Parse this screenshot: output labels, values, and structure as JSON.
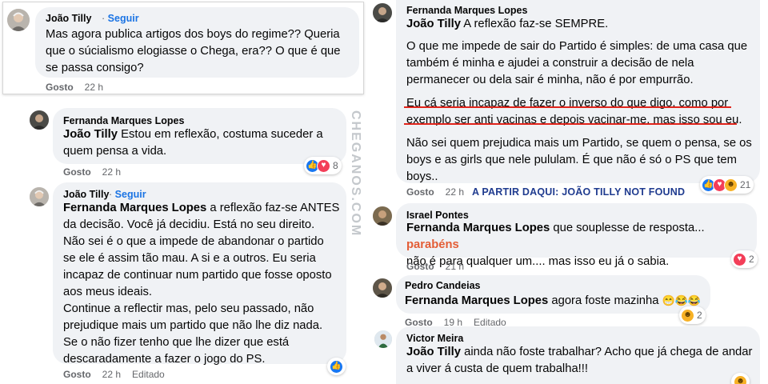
{
  "accent_colors": {
    "link_blue": "#1b74e4",
    "underline_red": "#e0241b",
    "note_blue": "#1f3b8f",
    "highlight_orange": "#e35d36"
  },
  "watermark": "CHEGANOS.COM",
  "comments": {
    "c1": {
      "author": "João Tilly",
      "follow_separator": "·",
      "follow_label": "Seguir",
      "lines": [
        "Mas agora publica artigos dos boys do regime?? Queria",
        "que o súcialismo elogiasse o Chega, era?? O que é que",
        "se passa consigo?"
      ],
      "like_label": "Gosto",
      "time": "22 h"
    },
    "c2": {
      "author": "Fernanda Marques Lopes",
      "mention": "João Tilly",
      "line1_rest": " Estou em reflexão, costuma suceder a",
      "line2": "quem pensa a vida.",
      "like_label": "Gosto",
      "time": "22 h",
      "reactions": {
        "icons": [
          "like-icon",
          "love-icon"
        ],
        "count": "8"
      }
    },
    "c3": {
      "author": "João Tilly",
      "follow_separator": "·",
      "follow_label": "Seguir",
      "mention": "Fernanda Marques Lopes",
      "line1_rest": " a reflexão faz-se ANTES",
      "lines": [
        "da decisão. Você já decidiu. Está no seu direito.",
        "Não sei é o que a impede de abandonar o partido",
        "se ele é assim tão mau. A si e a outros. Eu seria",
        "incapaz de continuar num partido que fosse oposto",
        "aos meus ideais.",
        "Continue a reflectir mas, pelo seu passado, não",
        "prejudique mais um partido que não lhe diz nada.",
        "Se o não fizer tenho que lhe dizer que está",
        "descaradamente a fazer o jogo do PS."
      ],
      "like_label": "Gosto",
      "time": "22 h",
      "edited": "Editado",
      "reactions": {
        "icons": [
          "like-icon"
        ]
      }
    },
    "c4": {
      "author": "Fernanda Marques Lopes",
      "mention": "João Tilly",
      "line1_rest": " A reflexão faz-se SEMPRE.",
      "lines_a": [
        "O que me impede de sair do Partido é simples: de uma casa que",
        "também é minha e ajudei a construir a decisão de nela",
        "permanecer ou dela sair é minha, não é por empurrão."
      ],
      "lines_b": [
        "Eu cá seria incapaz de fazer o inverso do que digo, como por",
        "exemplo ser anti vacinas e depois vacinar-me, mas isso sou eu."
      ],
      "lines_c": [
        "Não sei quem prejudica mais um Partido, se quem o pensa, se os",
        "boys e as girls que nele pululam. É que não é só o PS que tem",
        "boys.."
      ],
      "like_label": "Gosto",
      "time": "22 h",
      "annotation": "A PARTIR DAQUI: JOÃO TILLY NOT FOUND",
      "reactions": {
        "icons": [
          "like-icon",
          "love-icon",
          "haha-icon"
        ],
        "count": "21"
      }
    },
    "c5": {
      "author": "Israel Pontes",
      "mention": "Fernanda Marques Lopes",
      "line1_rest": " que souplesse de resposta...",
      "highlight": "parabéns",
      "line2": "não é para qualquer um.... mas isso eu já o sabia.",
      "like_label": "Gosto",
      "time": "21 h",
      "reactions": {
        "icons": [
          "love-icon"
        ],
        "count": "2"
      }
    },
    "c6": {
      "author": "Pedro Candeias",
      "mention": "Fernanda Marques Lopes",
      "line1_rest": " agora foste mazinha",
      "emojis": "😁😂😂",
      "like_label": "Gosto",
      "time": "19 h",
      "edited": "Editado",
      "reactions": {
        "icons": [
          "haha-icon"
        ],
        "count": "2"
      }
    },
    "c7": {
      "author": "Victor Meira",
      "mention": "João Tilly",
      "line1_rest": " ainda não foste trabalhar? Acho que já chega de andar",
      "line2": "a viver á custa de quem trabalha!!!",
      "reactions": {
        "icons": [
          "haha-icon"
        ]
      }
    }
  }
}
